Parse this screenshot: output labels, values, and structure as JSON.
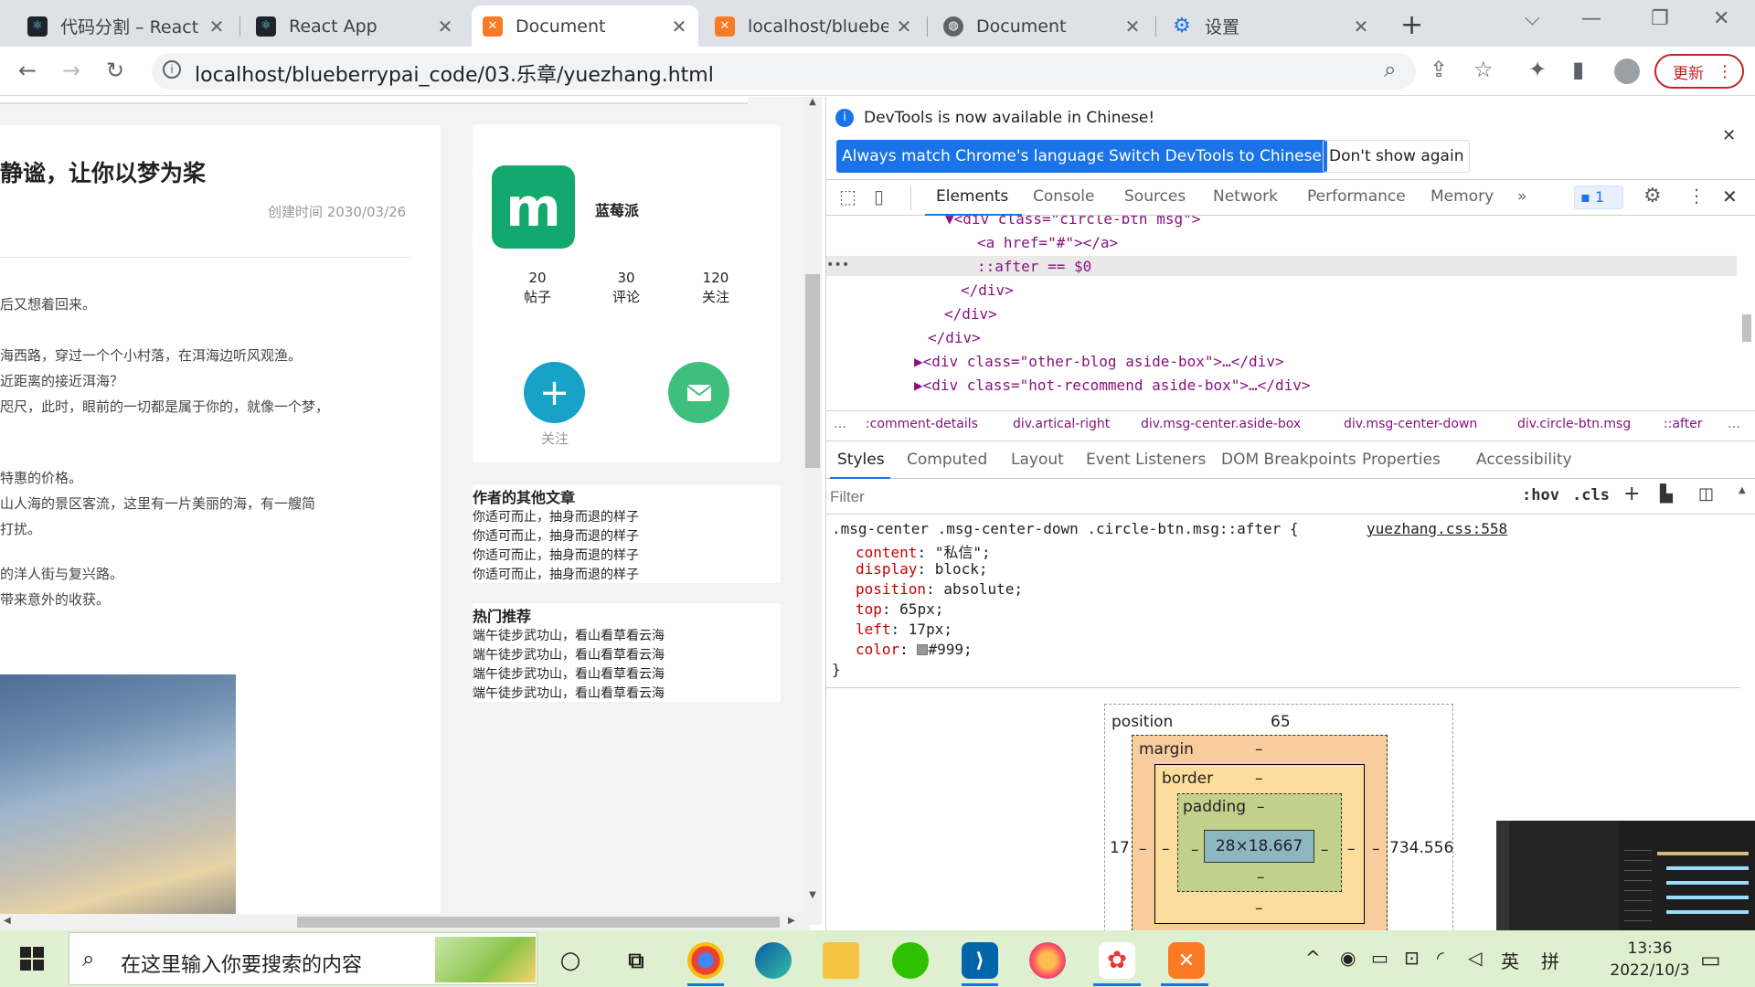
{
  "browser": {
    "tabs": [
      {
        "title": "代码分割 – React",
        "icon": "react-icon"
      },
      {
        "title": "React App",
        "icon": "react-icon"
      },
      {
        "title": "Document",
        "icon": "xampp-icon"
      },
      {
        "title": "localhost/blueberr",
        "icon": "xampp-icon"
      },
      {
        "title": "Document",
        "icon": "globe-icon"
      },
      {
        "title": "设置",
        "icon": "gear-icon"
      }
    ],
    "url": "localhost/blueberrypai_code/03.乐章/yuezhang.html",
    "update_label": "更新"
  },
  "page": {
    "article_title": "静谧，让你以梦为桨",
    "created": "创建时间 2030/03/26",
    "paragraphs": [
      "后又想着回来。",
      "海西路，穿过一个个小村落，在洱海边听风观渔。",
      "近距离的接近洱海？",
      "咫尺，此时，眼前的一切都是属于你的，就像一个梦，",
      "特惠的价格。",
      "山人海的景区客流，这里有一片美丽的海，有一艘简",
      "打扰。",
      "的洋人街与复兴路。",
      "带来意外的收获。"
    ],
    "profile": {
      "logo_text": "m",
      "name": "蓝莓派",
      "stats": [
        {
          "value": "20",
          "label": "帖子"
        },
        {
          "value": "30",
          "label": "评论"
        },
        {
          "value": "120",
          "label": "关注"
        }
      ],
      "follow_label": "关注"
    },
    "other_blog": {
      "title": "作者的其他文章",
      "items": [
        "你适可而止，抽身而退的样子",
        "你适可而止，抽身而退的样子",
        "你适可而止，抽身而退的样子",
        "你适可而止，抽身而退的样子"
      ]
    },
    "hot_recommend": {
      "title": "热门推荐",
      "items": [
        "端午徒步武功山，看山看草看云海",
        "端午徒步武功山，看山看草看云海",
        "端午徒步武功山，看山看草看云海",
        "端午徒步武功山，看山看草看云海"
      ]
    }
  },
  "devtools": {
    "info_text": "DevTools is now available in Chinese!",
    "btn_match": "Always match Chrome's language",
    "btn_switch": "Switch DevTools to Chinese",
    "btn_dont": "Don't show again",
    "tabs": [
      "Elements",
      "Console",
      "Sources",
      "Network",
      "Performance",
      "Memory"
    ],
    "issues_count": "1",
    "dom_lines": [
      "▼<div class=\"circle-btn msg\">",
      "<a href=\"#\"></a>",
      "::after == $0",
      "</div>",
      "</div>",
      "</div>",
      "▶<div class=\"other-blog aside-box\">…</div>",
      "▶<div class=\"hot-recommend aside-box\">…</div>"
    ],
    "breadcrumbs": [
      ":comment-details",
      "div.artical-right",
      "div.msg-center.aside-box",
      "div.msg-center-down",
      "div.circle-btn.msg",
      "::after"
    ],
    "style_tabs": [
      "Styles",
      "Computed",
      "Layout",
      "Event Listeners",
      "DOM Breakpoints",
      "Properties",
      "Accessibility"
    ],
    "filter_placeholder": "Filter",
    "hov": ":hov",
    "cls": ".cls",
    "selector": ".msg-center .msg-center-down .circle-btn.msg::after {",
    "source": "yuezhang.css:558",
    "declarations": [
      {
        "prop": "content",
        "value": "\"私信\";"
      },
      {
        "prop": "display",
        "value": "block;"
      },
      {
        "prop": "position",
        "value": "absolute;"
      },
      {
        "prop": "top",
        "value": "65px;"
      },
      {
        "prop": "left",
        "value": "17px;"
      },
      {
        "prop": "color",
        "value": "#999;"
      }
    ],
    "box_model": {
      "position_label": "position",
      "top": "65",
      "left": "17",
      "right": "734.556",
      "margin_label": "margin",
      "border_label": "border",
      "padding_label": "padding",
      "dash": "–",
      "content": "28×18.667"
    }
  },
  "taskbar": {
    "search_placeholder": "在这里输入你要搜索的内容",
    "time": "13:36",
    "date": "2022/10/3",
    "ime1": "英",
    "ime2": "拼"
  },
  "colors": {
    "brand_green": "#13a86d",
    "follow_blue": "#17a2c8",
    "msg_green": "#3fbf7c",
    "devtools_blue": "#1a73e8"
  }
}
